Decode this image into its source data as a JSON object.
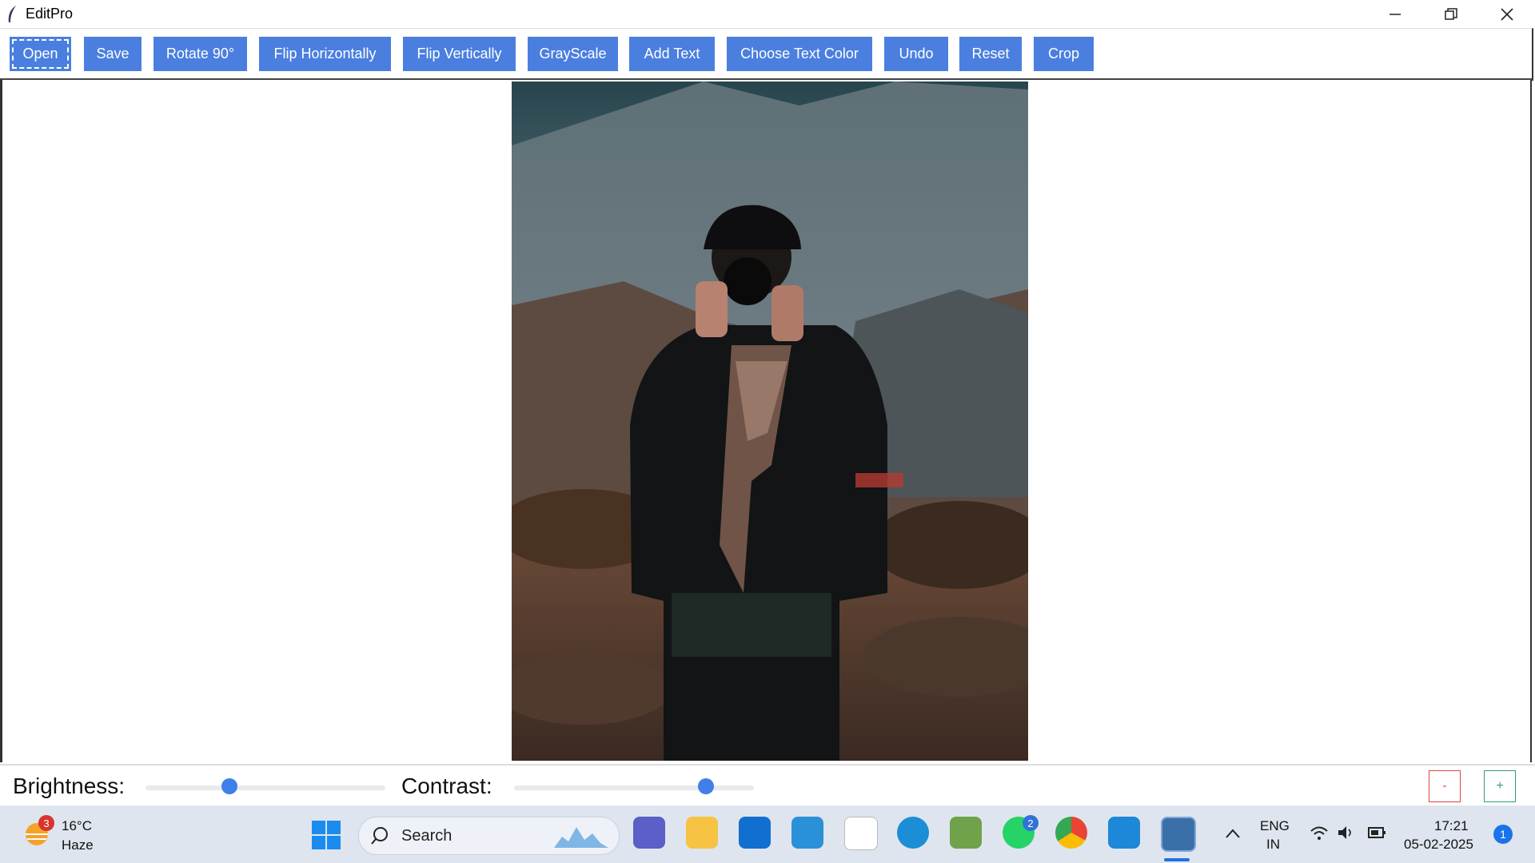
{
  "window": {
    "title": "EditPro"
  },
  "toolbar": {
    "buttons": [
      "Open",
      "Save",
      "Rotate 90°",
      "Flip Horizontally",
      "Flip Vertically",
      "GrayScale",
      "Add Text",
      "Choose Text Color",
      "Undo",
      "Reset",
      "Crop"
    ]
  },
  "adjustments": {
    "brightness_label": "Brightness:",
    "brightness_level": 0.35,
    "contrast_label": "Contrast:",
    "contrast_level": 0.8,
    "zoom_out": "-",
    "zoom_in": "+"
  },
  "taskbar": {
    "weather_temp": "16°C",
    "weather_cond": "Haze",
    "weather_badge": "3",
    "search_placeholder": "Search",
    "whatsapp_badge": "2",
    "lang_line1": "ENG",
    "lang_line2": "IN",
    "time": "17:21",
    "date": "05-02-2025",
    "notification_count": "1"
  },
  "colors": {
    "button_blue": "#4a7fe0",
    "slider_blue": "#3f7fe8"
  }
}
